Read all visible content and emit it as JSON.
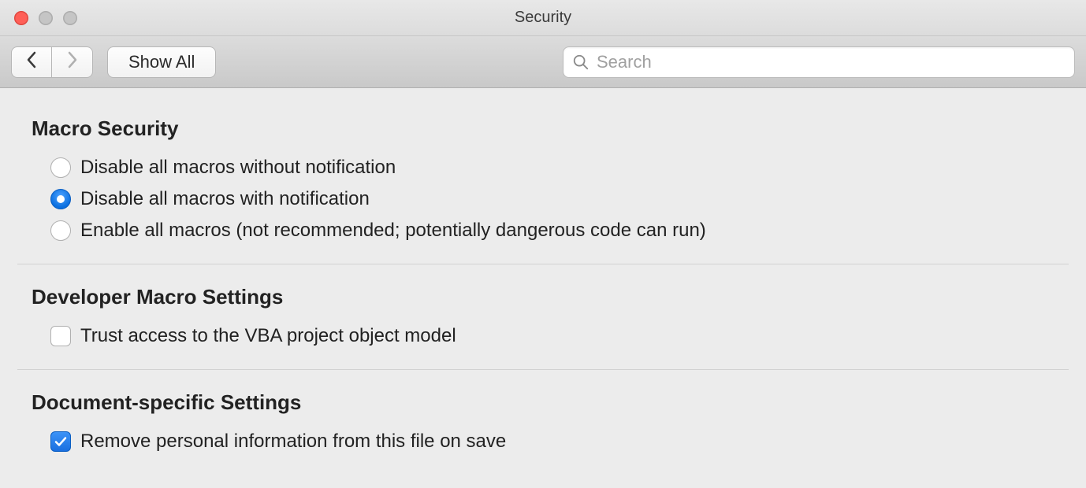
{
  "window": {
    "title": "Security"
  },
  "toolbar": {
    "showAllLabel": "Show All",
    "searchPlaceholder": "Search"
  },
  "sections": {
    "macroSecurity": {
      "title": "Macro Security",
      "options": [
        {
          "label": "Disable all macros without notification",
          "selected": false
        },
        {
          "label": "Disable all macros with notification",
          "selected": true
        },
        {
          "label": "Enable all macros (not recommended; potentially dangerous code can run)",
          "selected": false
        }
      ]
    },
    "developerMacro": {
      "title": "Developer Macro Settings",
      "options": [
        {
          "label": "Trust access to the VBA project object model",
          "checked": false
        }
      ]
    },
    "documentSpecific": {
      "title": "Document-specific Settings",
      "options": [
        {
          "label": "Remove personal information from this file on save",
          "checked": true
        }
      ]
    }
  }
}
